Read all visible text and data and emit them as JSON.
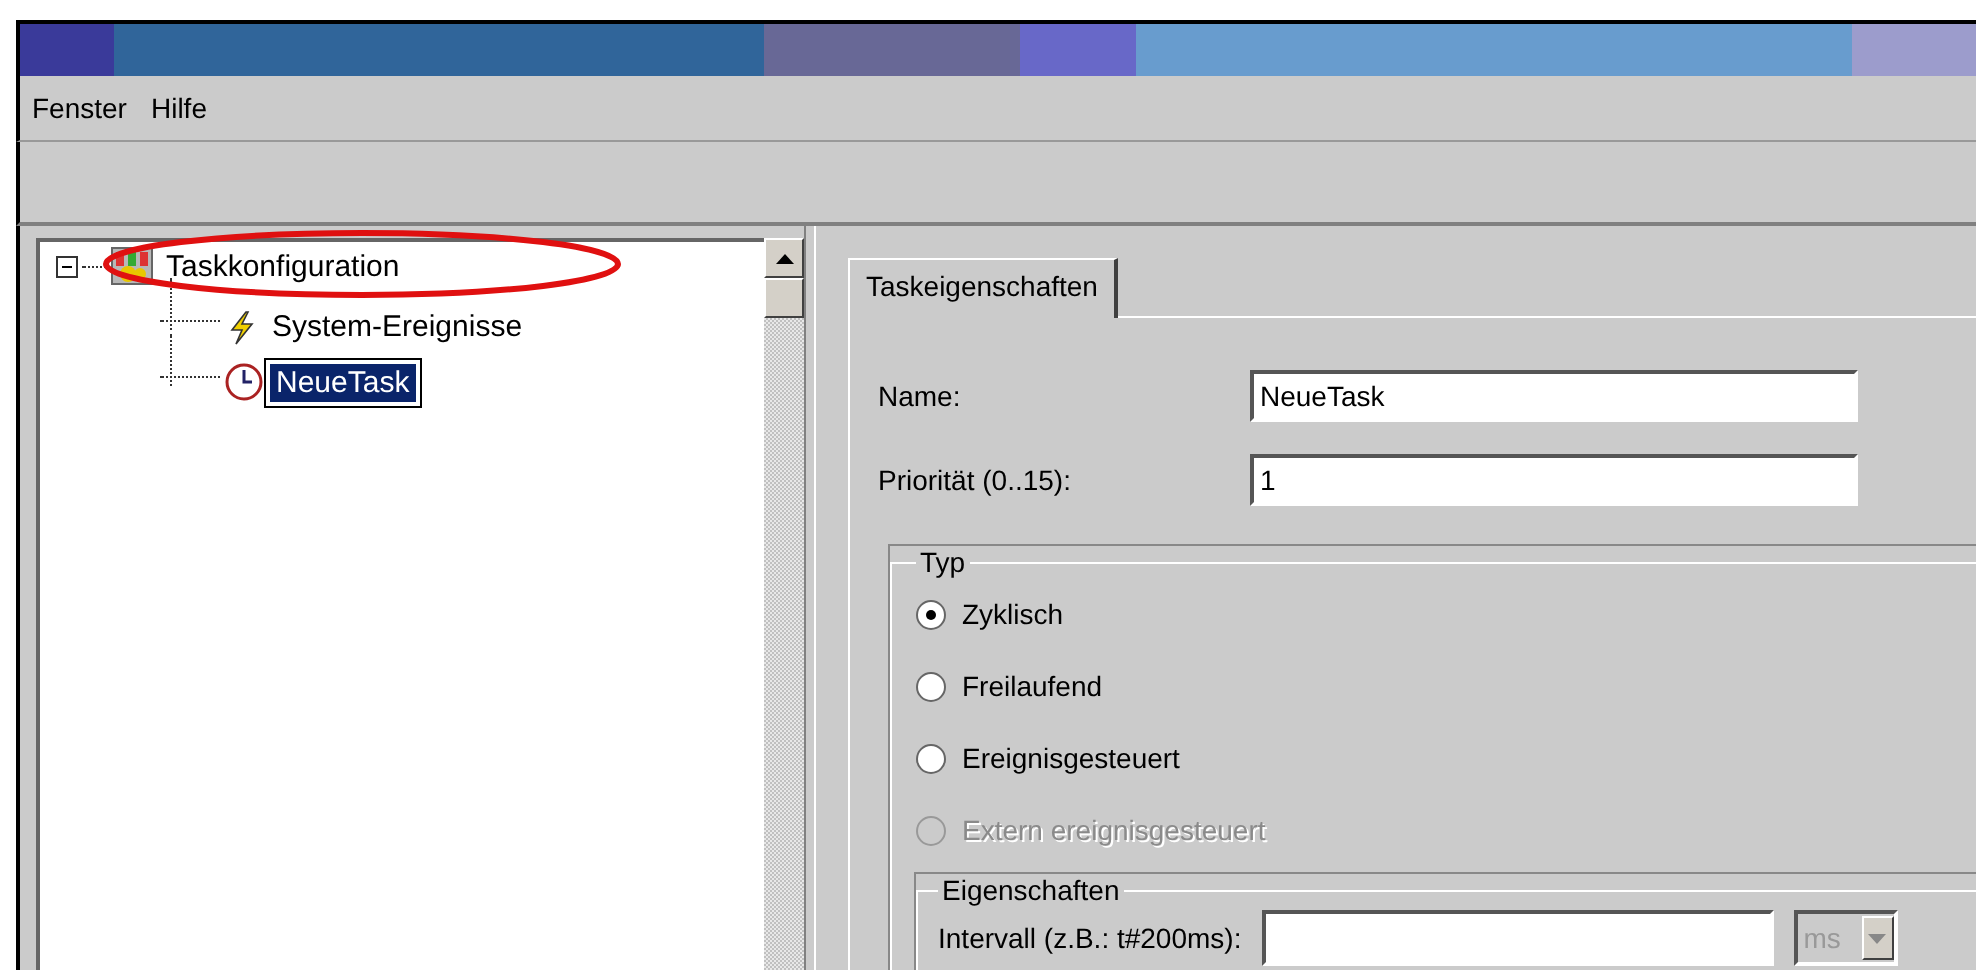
{
  "menu": [
    "Fenster",
    "Hilfe"
  ],
  "tree": {
    "items": [
      {
        "label": "Taskkonfiguration",
        "kind": "config",
        "expanded": true,
        "selected": false,
        "children": [
          {
            "label": "System-Ereignisse",
            "kind": "lightning",
            "selected": false
          },
          {
            "label": "NeueTask",
            "kind": "clock",
            "selected": true
          }
        ]
      }
    ]
  },
  "tabs": [
    {
      "label": "Taskeigenschaften",
      "selected": true
    }
  ],
  "fields": [
    {
      "label": "Name:",
      "value": "NeueTask"
    },
    {
      "label": "Priorität (0..15):",
      "value": "1"
    }
  ],
  "type_group": {
    "title": "Typ",
    "options": [
      {
        "label": "Zyklisch",
        "selected": true,
        "disabled": false
      },
      {
        "label": "Freilaufend",
        "selected": false,
        "disabled": false
      },
      {
        "label": "Ereignisgesteuert",
        "selected": false,
        "disabled": false
      },
      {
        "label": "Extern ereignisgesteuert",
        "selected": false,
        "disabled": true
      }
    ]
  },
  "properties_group": {
    "title": "Eigenschaften",
    "interval_label": "Intervall (z.B.: t#200ms):",
    "unit": {
      "value": "ms",
      "disabled": true
    }
  }
}
